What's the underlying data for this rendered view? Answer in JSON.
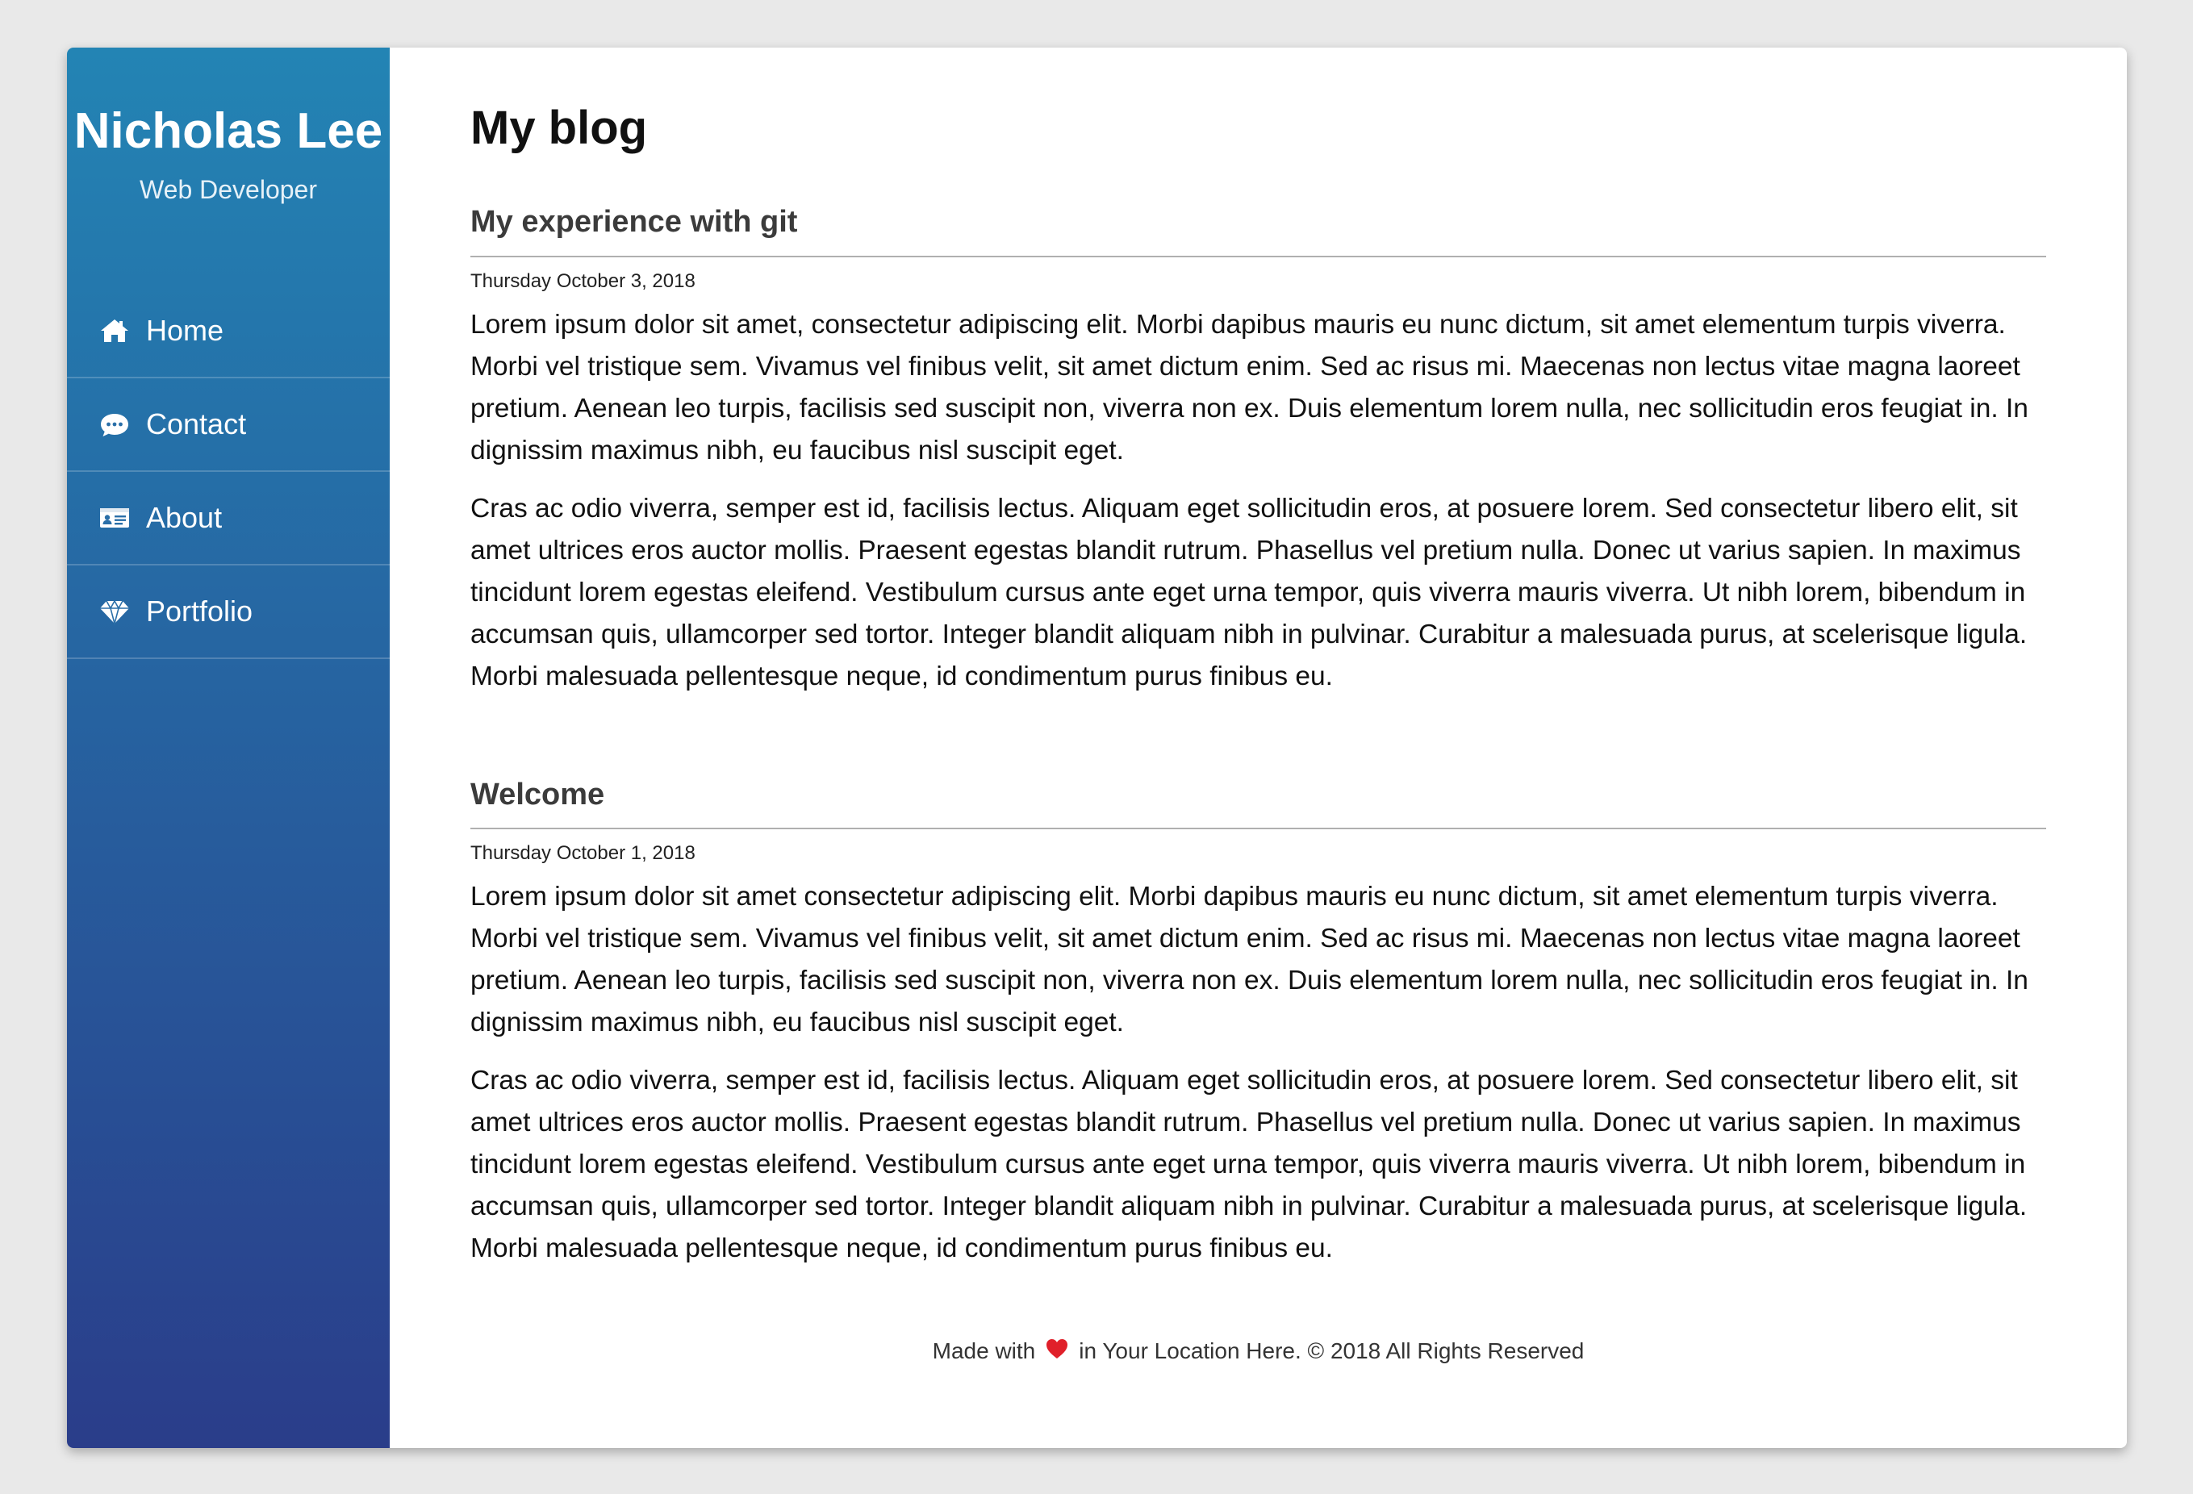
{
  "sidebar": {
    "name": "Nicholas Lee",
    "role": "Web Developer",
    "nav": [
      {
        "label": "Home",
        "icon": "home-icon"
      },
      {
        "label": "Contact",
        "icon": "chat-icon"
      },
      {
        "label": "About",
        "icon": "id-card-icon"
      },
      {
        "label": "Portfolio",
        "icon": "diamond-icon"
      }
    ],
    "gradient_top": "#2384b4",
    "gradient_bottom": "#2a3d8a"
  },
  "main": {
    "title": "My blog",
    "posts": [
      {
        "title": "My experience with git",
        "date": "Thursday October 3, 2018",
        "paragraphs": [
          "Lorem ipsum dolor sit amet, consectetur adipiscing elit. Morbi dapibus mauris eu nunc dictum, sit amet elementum turpis viverra. Morbi vel tristique sem. Vivamus vel finibus velit, sit amet dictum enim. Sed ac risus mi. Maecenas non lectus vitae magna laoreet pretium. Aenean leo turpis, facilisis sed suscipit non, viverra non ex. Duis elementum lorem nulla, nec sollicitudin eros feugiat in. In dignissim maximus nibh, eu faucibus nisl suscipit eget.",
          "Cras ac odio viverra, semper est id, facilisis lectus. Aliquam eget sollicitudin eros, at posuere lorem. Sed consectetur libero elit, sit amet ultrices eros auctor mollis. Praesent egestas blandit rutrum. Phasellus vel pretium nulla. Donec ut varius sapien. In maximus tincidunt lorem egestas eleifend. Vestibulum cursus ante eget urna tempor, quis viverra mauris viverra. Ut nibh lorem, bibendum in accumsan quis, ullamcorper sed tortor. Integer blandit aliquam nibh in pulvinar. Curabitur a malesuada purus, at scelerisque ligula. Morbi malesuada pellentesque neque, id condimentum purus finibus eu."
        ]
      },
      {
        "title": "Welcome",
        "date": "Thursday October 1, 2018",
        "paragraphs": [
          "Lorem ipsum dolor sit amet consectetur adipiscing elit. Morbi dapibus mauris eu nunc dictum, sit amet elementum turpis viverra. Morbi vel tristique sem. Vivamus vel finibus velit, sit amet dictum enim. Sed ac risus mi. Maecenas non lectus vitae magna laoreet pretium. Aenean leo turpis, facilisis sed suscipit non, viverra non ex. Duis elementum lorem nulla, nec sollicitudin eros feugiat in. In dignissim maximus nibh, eu faucibus nisl suscipit eget.",
          "Cras ac odio viverra, semper est id, facilisis lectus. Aliquam eget sollicitudin eros, at posuere lorem. Sed consectetur libero elit, sit amet ultrices eros auctor mollis. Praesent egestas blandit rutrum. Phasellus vel pretium nulla. Donec ut varius sapien. In maximus tincidunt lorem egestas eleifend. Vestibulum cursus ante eget urna tempor, quis viverra mauris viverra. Ut nibh lorem, bibendum in accumsan quis, ullamcorper sed tortor. Integer blandit aliquam nibh in pulvinar. Curabitur a malesuada purus, at scelerisque ligula. Morbi malesuada pellentesque neque, id condimentum purus finibus eu."
        ]
      }
    ]
  },
  "footer": {
    "prefix": "Made with",
    "suffix": "in Your Location Here. © 2018 All Rights Reserved",
    "heart_icon": "heart-icon",
    "heart_color": "#e0202a"
  }
}
